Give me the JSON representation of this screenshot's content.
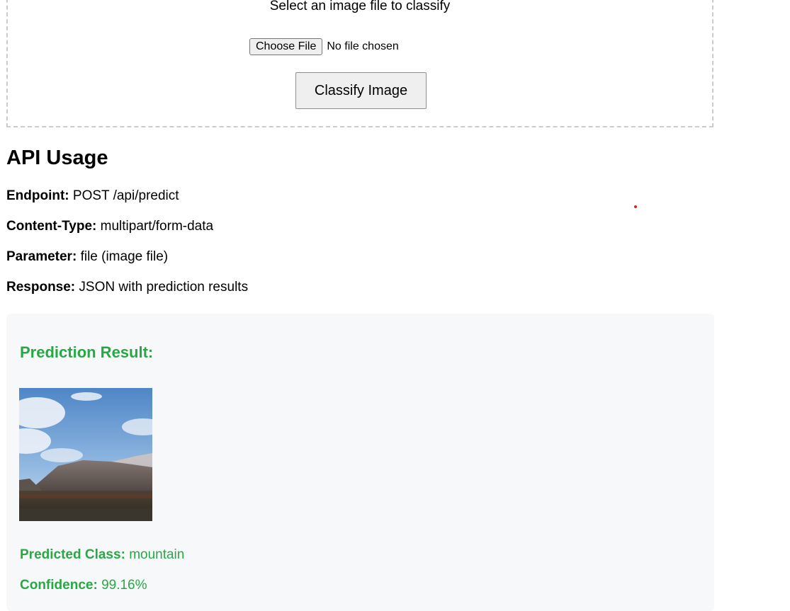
{
  "upload": {
    "prompt": "Select an image file to classify",
    "choose_file_label": "Choose File",
    "file_status": "No file chosen",
    "classify_label": "Classify Image"
  },
  "api": {
    "title": "API Usage",
    "lines": [
      {
        "label": "Endpoint:",
        "value": "POST /api/predict"
      },
      {
        "label": "Content-Type:",
        "value": "multipart/form-data"
      },
      {
        "label": "Parameter:",
        "value": "file (image file)"
      },
      {
        "label": "Response:",
        "value": "JSON with prediction results"
      }
    ]
  },
  "result": {
    "title": "Prediction Result:",
    "image_alt": "uploaded-image",
    "predicted_class_label": "Predicted Class:",
    "predicted_class": "mountain",
    "confidence_label": "Confidence:",
    "confidence": "99.16%"
  },
  "colors": {
    "success": "#29a745",
    "panel_bg": "#f7f8f9",
    "border_dashed": "#cccccc",
    "marker": "#d9211f"
  }
}
